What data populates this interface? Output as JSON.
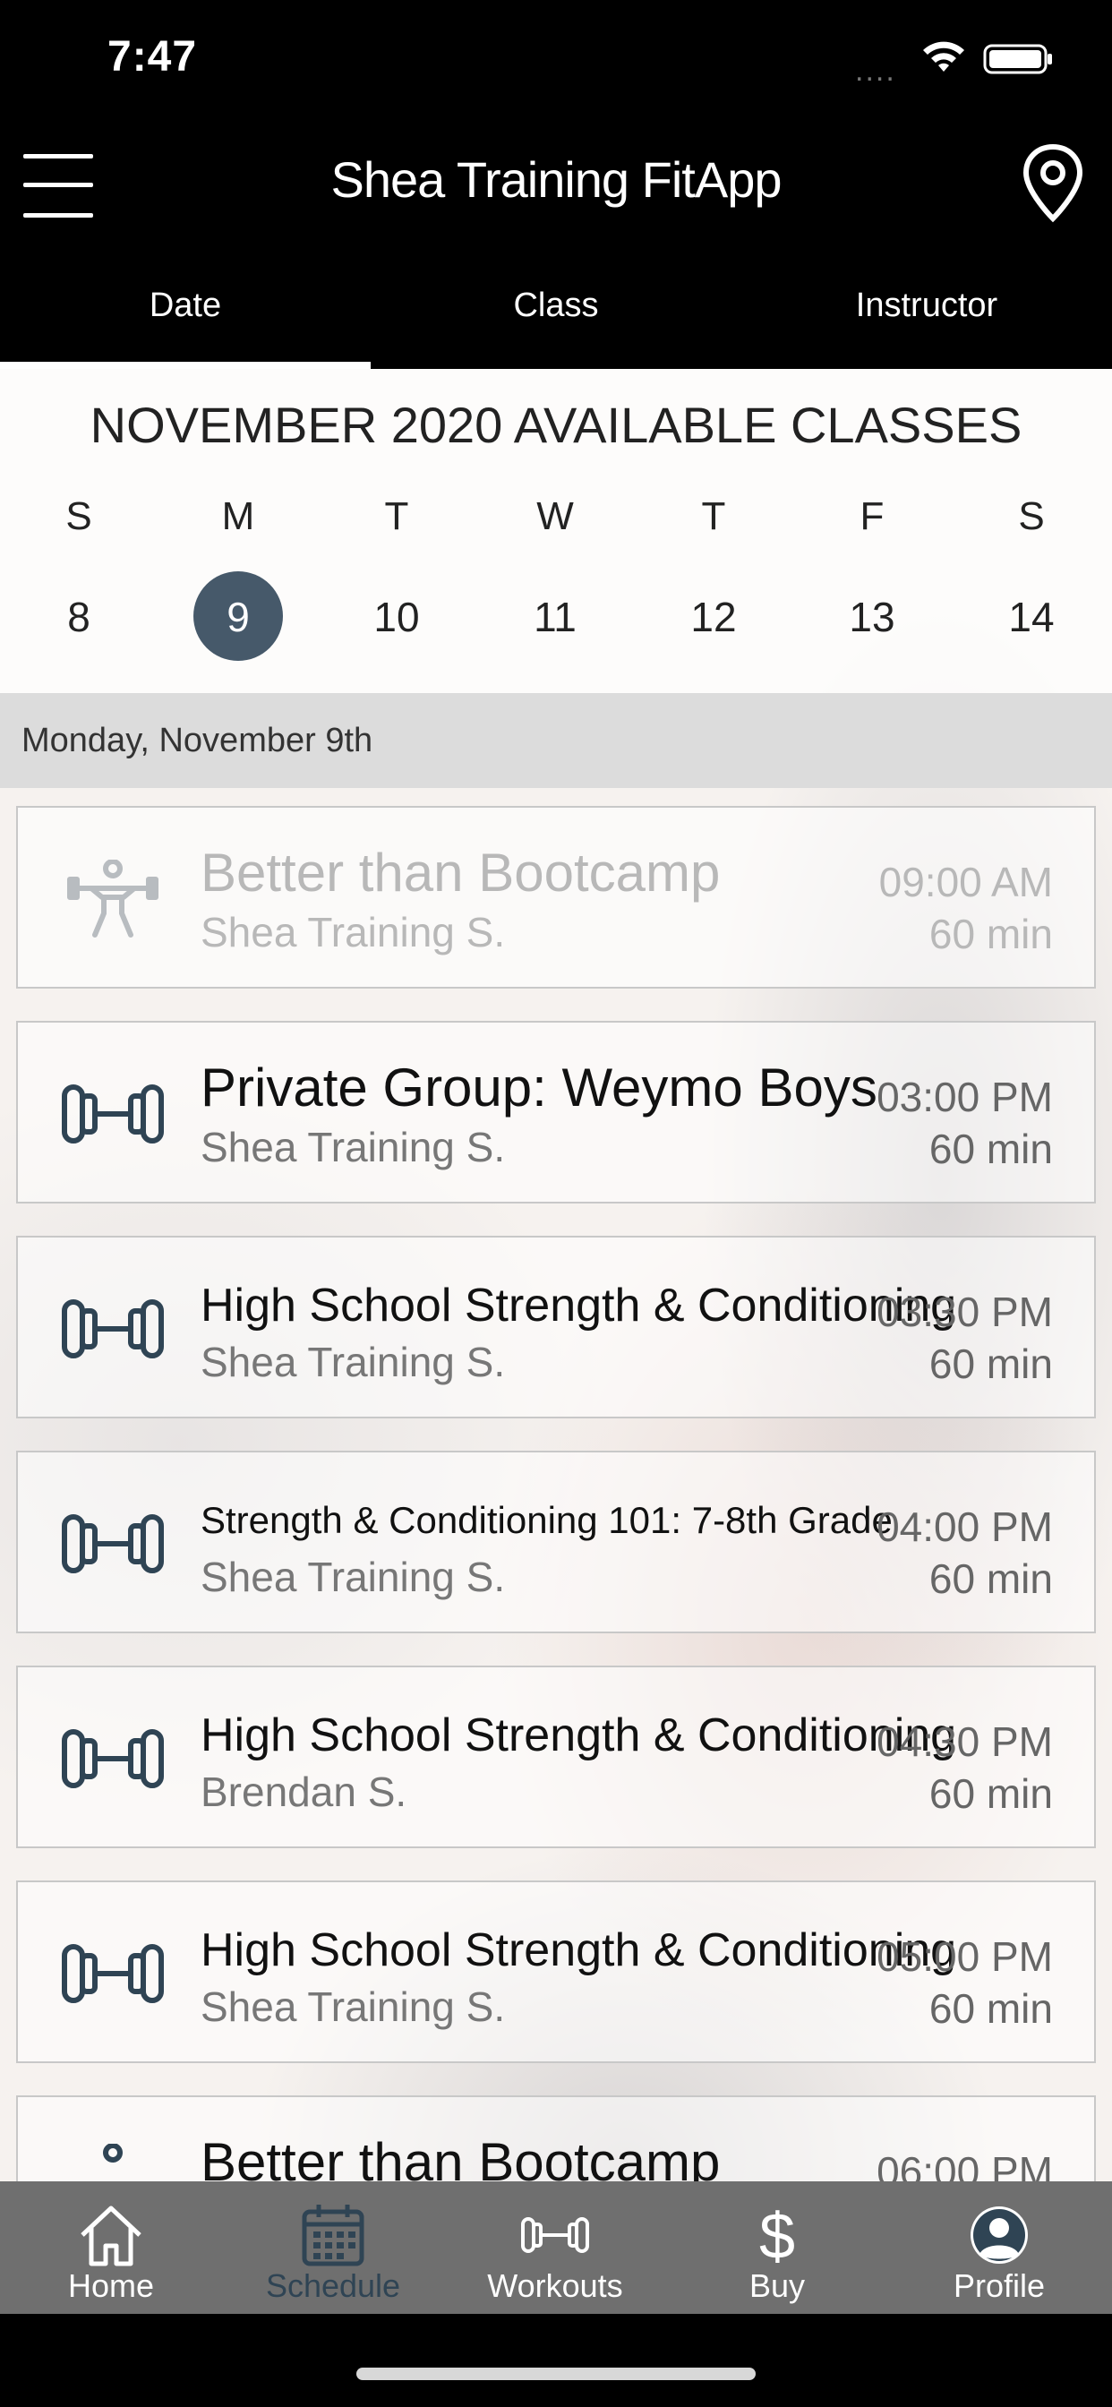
{
  "status_bar": {
    "time": "7:47",
    "signal": "....",
    "icons": [
      "wifi-icon",
      "battery-icon"
    ]
  },
  "header": {
    "title": "Shea Training FitApp",
    "left_icon": "menu-icon",
    "right_icon": "location-pin-icon",
    "tabs": [
      {
        "label": "Date",
        "active": true
      },
      {
        "label": "Class",
        "active": false
      },
      {
        "label": "Instructor",
        "active": false
      }
    ]
  },
  "calendar": {
    "title": "NOVEMBER 2020 AVAILABLE CLASSES",
    "days_of_week": [
      "S",
      "M",
      "T",
      "W",
      "T",
      "F",
      "S"
    ],
    "dates": [
      "8",
      "9",
      "10",
      "11",
      "12",
      "13",
      "14"
    ],
    "selected_date": "9"
  },
  "date_header": "Monday, November 9th",
  "classes": [
    {
      "title": "Better than Bootcamp",
      "instructor": "Shea Training S.",
      "time": "09:00 AM",
      "duration": "60 min",
      "icon": "weightlifter-icon",
      "past": true
    },
    {
      "title": "Private Group: Weymo Boys",
      "instructor": "Shea Training S.",
      "time": "03:00 PM",
      "duration": "60 min",
      "icon": "dumbbell-icon",
      "past": false
    },
    {
      "title": "High School Strength & Conditioning",
      "instructor": "Shea Training S.",
      "time": "03:30 PM",
      "duration": "60 min",
      "icon": "dumbbell-icon",
      "past": false
    },
    {
      "title": "Strength & Conditioning 101: 7-8th Grade",
      "instructor": "Shea Training S.",
      "time": "04:00 PM",
      "duration": "60 min",
      "icon": "dumbbell-icon",
      "past": false
    },
    {
      "title": "High School Strength & Conditioning",
      "instructor": "Brendan S.",
      "time": "04:30 PM",
      "duration": "60 min",
      "icon": "dumbbell-icon",
      "past": false
    },
    {
      "title": "High School Strength & Conditioning",
      "instructor": "Shea Training S.",
      "time": "05:00 PM",
      "duration": "60 min",
      "icon": "dumbbell-icon",
      "past": false
    },
    {
      "title": "Better than Bootcamp",
      "instructor": "",
      "time": "06:00 PM",
      "duration": "",
      "icon": "weightlifter-icon",
      "past": false
    }
  ],
  "bottom_nav": [
    {
      "label": "Home",
      "icon": "home-icon",
      "active": false
    },
    {
      "label": "Schedule",
      "icon": "calendar-icon",
      "active": true
    },
    {
      "label": "Workouts",
      "icon": "dumbbell-icon",
      "active": false
    },
    {
      "label": "Buy",
      "icon": "dollar-icon",
      "active": false
    },
    {
      "label": "Profile",
      "icon": "profile-icon",
      "active": false
    }
  ],
  "colors": {
    "header_bg": "#000000",
    "accent": "#2f4454",
    "selected_date": "#46596a",
    "nav_bg": "#6f6f6f"
  }
}
